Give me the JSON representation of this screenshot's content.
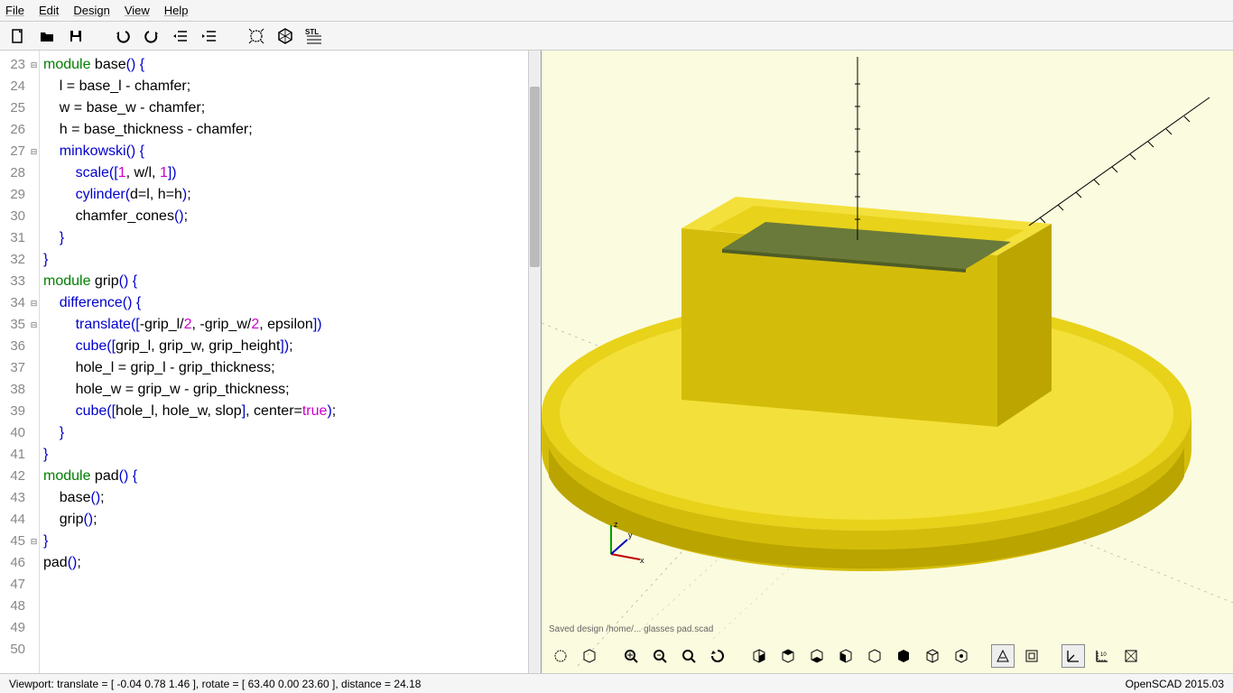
{
  "menu": {
    "file": "File",
    "edit": "Edit",
    "design": "Design",
    "view": "View",
    "help": "Help"
  },
  "toolbar": {
    "new": "new",
    "open": "open",
    "save": "save",
    "undo": "undo",
    "redo": "redo",
    "indent": "indent",
    "outdent": "outdent",
    "preview": "preview",
    "render": "render",
    "stl": "STL"
  },
  "editor": {
    "first_line": 23,
    "lines": [
      {
        "n": 23,
        "fold": "⊟",
        "html": "<span class='kw'>module</span> base<span class='br'>() {</span>"
      },
      {
        "n": 24,
        "fold": "",
        "html": "    l = base_l - chamfer;"
      },
      {
        "n": 25,
        "fold": "",
        "html": "    w = base_w - chamfer;"
      },
      {
        "n": 26,
        "fold": "",
        "html": "    h = base_thickness - chamfer;"
      },
      {
        "n": 27,
        "fold": "⊟",
        "html": "    <span class='fn'>minkowski</span><span class='br'>() {</span>"
      },
      {
        "n": 28,
        "fold": "",
        "html": "        <span class='fn'>scale</span><span class='br'>([</span><span class='num'>1</span>, w/l, <span class='num'>1</span><span class='br'>])</span>"
      },
      {
        "n": 29,
        "fold": "",
        "html": "        <span class='fn'>cylinder</span><span class='br'>(</span>d=l, h=h<span class='br'>)</span>;"
      },
      {
        "n": 30,
        "fold": "",
        "html": "        chamfer_cones<span class='br'>()</span>;"
      },
      {
        "n": 31,
        "fold": "",
        "html": "    <span class='br'>}</span>"
      },
      {
        "n": 32,
        "fold": "",
        "html": "<span class='br'>}</span>"
      },
      {
        "n": 33,
        "fold": "",
        "html": ""
      },
      {
        "n": 34,
        "fold": "⊟",
        "html": "<span class='kw'>module</span> grip<span class='br'>() {</span>"
      },
      {
        "n": 35,
        "fold": "⊟",
        "html": "    <span class='fn'>difference</span><span class='br'>() {</span>"
      },
      {
        "n": 36,
        "fold": "",
        "html": "        <span class='fn'>translate</span><span class='br'>([</span>-grip_l/<span class='num'>2</span>, -grip_w/<span class='num'>2</span>, epsilon<span class='br'>])</span>"
      },
      {
        "n": 37,
        "fold": "",
        "html": "        <span class='fn'>cube</span><span class='br'>([</span>grip_l, grip_w, grip_height<span class='br'>])</span>;"
      },
      {
        "n": 38,
        "fold": "",
        "html": ""
      },
      {
        "n": 39,
        "fold": "",
        "html": "        hole_l = grip_l - grip_thickness;"
      },
      {
        "n": 40,
        "fold": "",
        "html": "        hole_w = grip_w - grip_thickness;"
      },
      {
        "n": 41,
        "fold": "",
        "html": "        <span class='fn'>cube</span><span class='br'>([</span>hole_l, hole_w, slop<span class='br'>]</span>, center=<span class='bool'>true</span><span class='br'>)</span>;"
      },
      {
        "n": 42,
        "fold": "",
        "html": "    <span class='br'>}</span>"
      },
      {
        "n": 43,
        "fold": "",
        "html": "<span class='br'>}</span>"
      },
      {
        "n": 44,
        "fold": "",
        "html": ""
      },
      {
        "n": 45,
        "fold": "⊟",
        "html": "<span class='kw'>module</span> pad<span class='br'>() {</span>"
      },
      {
        "n": 46,
        "fold": "",
        "html": "    base<span class='br'>()</span>;"
      },
      {
        "n": 47,
        "fold": "",
        "html": "    grip<span class='br'>()</span>;"
      },
      {
        "n": 48,
        "fold": "",
        "html": "<span class='br'>}</span>"
      },
      {
        "n": 49,
        "fold": "",
        "html": ""
      },
      {
        "n": 50,
        "fold": "",
        "html": "pad<span class='br'>()</span>;"
      }
    ]
  },
  "axis": {
    "x": "x",
    "y": "y",
    "z": "z"
  },
  "status": {
    "left": "Viewport: translate = [ -0.04 0.78 1.46 ], rotate = [ 63.40 0.00 23.60 ], distance = 24.18",
    "right": "OpenSCAD 2015.03"
  },
  "viewport_strip": "Saved design /home/... glasses pad.scad"
}
